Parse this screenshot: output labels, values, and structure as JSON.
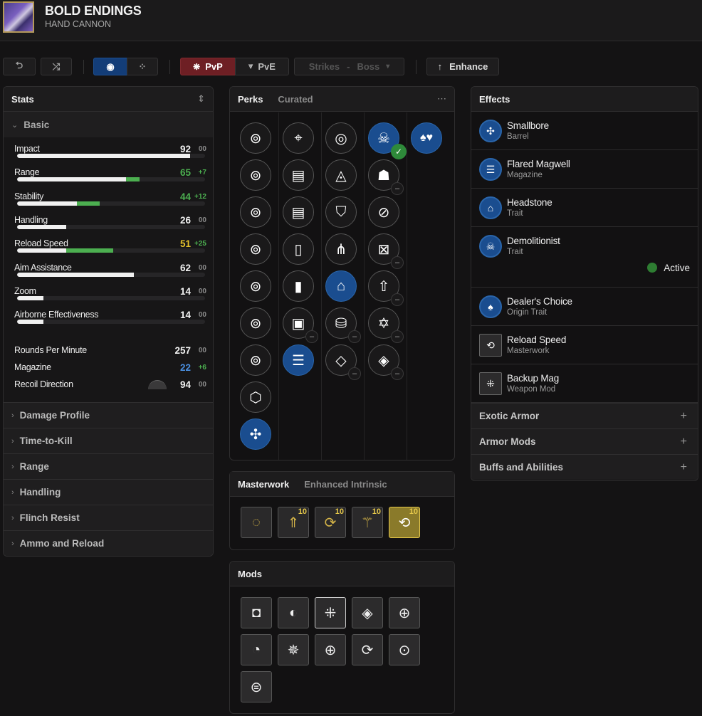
{
  "header": {
    "title": "BOLD ENDINGS",
    "subtitle": "HAND CANNON"
  },
  "toolbar": {
    "undo_icon": "⮌",
    "shuffle_icon": "⤮",
    "view_single_icon": "◉",
    "view_grid_icon": "⁘",
    "pvp_label": "PvP",
    "pvp_icon": "❋",
    "pve_label": "PvE",
    "pve_icon": "⩔",
    "activity_label": "Strikes",
    "activity_sep": "-",
    "activity_target": "Boss",
    "activity_caret": "▾",
    "enhance_label": "Enhance",
    "enhance_icon": "↑",
    "colors": {
      "pvp_active": "#6e1f24",
      "view_active": "#133d78"
    }
  },
  "stats": {
    "title": "Stats",
    "reorder_icon": "⇕",
    "basic_label": "Basic",
    "bars": [
      {
        "name": "Impact",
        "value": "92",
        "mod": "00",
        "base": 92,
        "bonus": 0,
        "color": "#f2f2f2",
        "modcolor": "#8a8a8a"
      },
      {
        "name": "Range",
        "value": "65",
        "mod": "+7",
        "base": 58,
        "bonus": 7,
        "color": "#4caf50",
        "modcolor": "#4caf50"
      },
      {
        "name": "Stability",
        "value": "44",
        "mod": "+12",
        "base": 32,
        "bonus": 12,
        "color": "#4caf50",
        "modcolor": "#4caf50"
      },
      {
        "name": "Handling",
        "value": "26",
        "mod": "00",
        "base": 26,
        "bonus": 0,
        "color": "#f2f2f2",
        "modcolor": "#8a8a8a"
      },
      {
        "name": "Reload Speed",
        "value": "51",
        "mod": "+25",
        "base": 26,
        "bonus": 25,
        "color": "#e6c32c",
        "modcolor": "#4caf50"
      },
      {
        "name": "Aim Assistance",
        "value": "62",
        "mod": "00",
        "base": 62,
        "bonus": 0,
        "color": "#f2f2f2",
        "modcolor": "#8a8a8a"
      },
      {
        "name": "Zoom",
        "value": "14",
        "mod": "00",
        "base": 14,
        "bonus": 0,
        "color": "#f2f2f2",
        "modcolor": "#8a8a8a"
      },
      {
        "name": "Airborne Effectiveness",
        "value": "14",
        "mod": "00",
        "base": 14,
        "bonus": 0,
        "color": "#f2f2f2",
        "modcolor": "#8a8a8a"
      }
    ],
    "plain": [
      {
        "name": "Rounds Per Minute",
        "value": "257",
        "mod": "00",
        "color": "#f2f2f2",
        "modcolor": "#8a8a8a"
      },
      {
        "name": "Magazine",
        "value": "22",
        "mod": "+6",
        "color": "#4a8fe0",
        "modcolor": "#4caf50"
      },
      {
        "name": "Recoil Direction",
        "value": "94",
        "mod": "00",
        "color": "#f2f2f2",
        "modcolor": "#8a8a8a"
      }
    ],
    "sections": [
      "Damage Profile",
      "Time-to-Kill",
      "Range",
      "Handling",
      "Flinch Resist",
      "Ammo and Reload"
    ]
  },
  "perks": {
    "tab_active": "Perks",
    "tab_inactive": "Curated",
    "more_icon": "⋯",
    "columns": [
      [
        {
          "icon": "barrel",
          "g": "⊚"
        },
        {
          "icon": "barrel",
          "g": "⊚"
        },
        {
          "icon": "barrel",
          "g": "⊚"
        },
        {
          "icon": "barrel",
          "g": "⊚"
        },
        {
          "icon": "barrel",
          "g": "⊚"
        },
        {
          "icon": "barrel",
          "g": "⊚"
        },
        {
          "icon": "barrel",
          "g": "⊚"
        },
        {
          "icon": "barrel",
          "g": "⬡"
        },
        {
          "icon": "smallbore",
          "g": "✣",
          "sel": true
        }
      ],
      [
        {
          "icon": "magazine",
          "g": "⌖"
        },
        {
          "icon": "magazine",
          "g": "▤"
        },
        {
          "icon": "magazine",
          "g": "▤"
        },
        {
          "icon": "magazine",
          "g": "▯"
        },
        {
          "icon": "magazine",
          "g": "▮"
        },
        {
          "icon": "magazine",
          "g": "▣",
          "minus": true
        },
        {
          "icon": "flared-magwell",
          "g": "☰",
          "sel": true
        }
      ],
      [
        {
          "icon": "trait",
          "g": "◎"
        },
        {
          "icon": "trait",
          "g": "◬"
        },
        {
          "icon": "trait",
          "g": "⛉"
        },
        {
          "icon": "trait",
          "g": "⋔"
        },
        {
          "icon": "headstone",
          "g": "⌂",
          "sel": true
        },
        {
          "icon": "trait",
          "g": "⛁",
          "minus": true
        },
        {
          "icon": "trait",
          "g": "◇",
          "minus": true
        }
      ],
      [
        {
          "icon": "demolitionist",
          "g": "☠",
          "sel": true,
          "check": true
        },
        {
          "icon": "trait",
          "g": "☗",
          "minus": true
        },
        {
          "icon": "trait",
          "g": "⊘"
        },
        {
          "icon": "trait",
          "g": "⊠",
          "minus": true
        },
        {
          "icon": "trait",
          "g": "⇧",
          "minus": true
        },
        {
          "icon": "trait",
          "g": "✡",
          "minus": true
        },
        {
          "icon": "trait",
          "g": "◈",
          "minus": true
        }
      ],
      [
        {
          "icon": "dealers-choice",
          "g": "♠♥",
          "sel": true
        }
      ]
    ]
  },
  "masterwork": {
    "tab_active": "Masterwork",
    "tab_inactive": "Enhanced Intrinsic",
    "items": [
      {
        "icon": "empty-socket",
        "g": "◌",
        "level": ""
      },
      {
        "icon": "range-masterwork",
        "g": "⇑",
        "level": "10"
      },
      {
        "icon": "handling-masterwork",
        "g": "⟳",
        "level": "10"
      },
      {
        "icon": "stability-masterwork",
        "g": "⚚",
        "level": "10"
      },
      {
        "icon": "reload-masterwork",
        "g": "⟲",
        "level": "10",
        "active": true
      }
    ]
  },
  "mods": {
    "title": "Mods",
    "items": [
      {
        "icon": "empty-mod",
        "g": "◘"
      },
      {
        "icon": "half-circle-mod",
        "g": "◐"
      },
      {
        "icon": "backup-mag-mod",
        "g": "⁜",
        "sel": true
      },
      {
        "icon": "diamond-mod",
        "g": "◈"
      },
      {
        "icon": "targeting-mod",
        "g": "⊕"
      },
      {
        "icon": "radar-mod",
        "g": "◔"
      },
      {
        "icon": "snowflake-mod",
        "g": "✵"
      },
      {
        "icon": "freehand-mod",
        "g": "⊕"
      },
      {
        "icon": "rotate-target-mod",
        "g": "⟳"
      },
      {
        "icon": "reload-mod",
        "g": "⊙"
      },
      {
        "icon": "mag-mod",
        "g": "⊜"
      }
    ]
  },
  "effects": {
    "title": "Effects",
    "items": [
      {
        "name": "Smallbore",
        "type": "Barrel",
        "icon": "smallbore-icon",
        "g": "✣",
        "shape": "round"
      },
      {
        "name": "Flared Magwell",
        "type": "Magazine",
        "icon": "flared-magwell-icon",
        "g": "☰",
        "shape": "round"
      },
      {
        "name": "Headstone",
        "type": "Trait",
        "icon": "headstone-icon",
        "g": "⌂",
        "shape": "round"
      },
      {
        "name": "Demolitionist",
        "type": "Trait",
        "icon": "demolitionist-icon",
        "g": "☠",
        "shape": "round",
        "status": "Active"
      },
      {
        "name": "Dealer's Choice",
        "type": "Origin Trait",
        "icon": "dealers-choice-icon",
        "g": "♠",
        "shape": "round"
      },
      {
        "name": "Reload Speed",
        "type": "Masterwork",
        "icon": "reload-masterwork-icon",
        "g": "⟲",
        "shape": "square"
      },
      {
        "name": "Backup Mag",
        "type": "Weapon Mod",
        "icon": "backup-mag-icon",
        "g": "⁜",
        "shape": "square"
      }
    ],
    "sections": [
      "Exotic Armor",
      "Armor Mods",
      "Buffs and Abilities"
    ],
    "plus_icon": "+",
    "active_color": "#2e7d32"
  }
}
